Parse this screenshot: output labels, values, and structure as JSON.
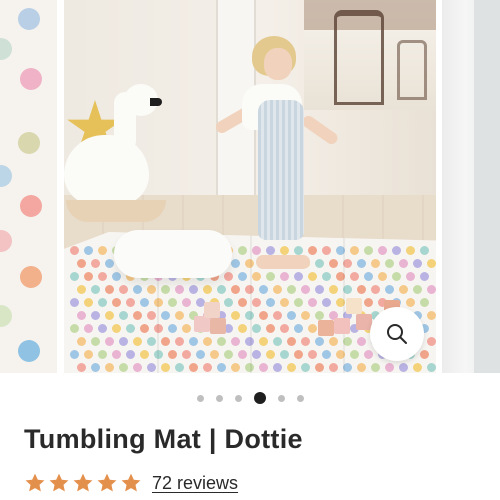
{
  "product": {
    "title": "Tumbling Mat | Dottie",
    "rating": 5,
    "reviews_label": "72 reviews"
  },
  "carousel": {
    "slide_count": 6,
    "active_index": 3
  },
  "colors": {
    "star": "#e4904d",
    "active_dot": "#1f1f1f",
    "inactive_dot": "#bfbfbf",
    "title_text": "#2a2a2a"
  },
  "icons": {
    "zoom": "magnifier-icon",
    "star": "star-icon"
  }
}
